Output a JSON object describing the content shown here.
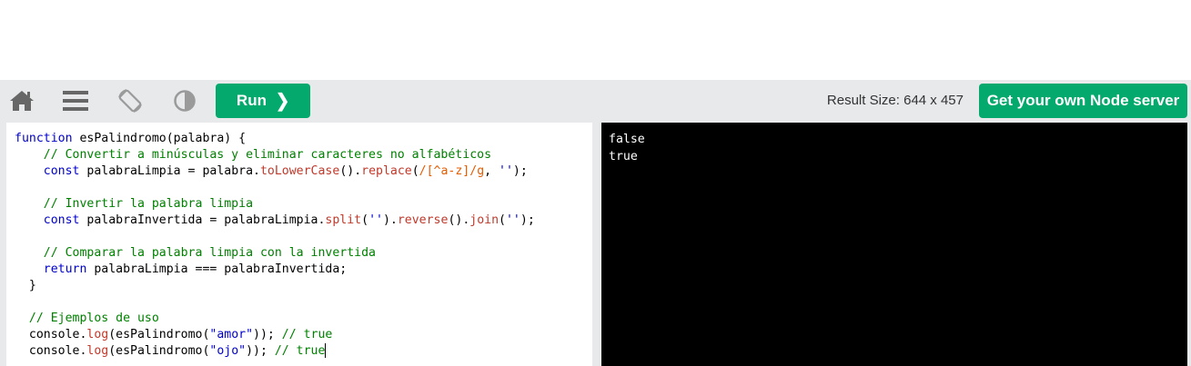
{
  "toolbar": {
    "icons": {
      "home": "home-icon",
      "menu": "menu-icon",
      "rotate": "rotate-screen-icon",
      "contrast": "contrast-icon"
    },
    "run_label": "Run",
    "run_chevron": "❯",
    "result_size_label": "Result Size: 644 x 457",
    "get_server_label": "Get your own Node server",
    "colors": {
      "accent": "#04aa6d",
      "toolbar_bg": "#e7e9eb",
      "icon": "#676767"
    }
  },
  "editor": {
    "lines": [
      [
        {
          "t": "function",
          "c": "kw"
        },
        {
          "t": " esPalindromo(palabra) {",
          "c": ""
        }
      ],
      [
        {
          "t": "    // Convertir a minúsculas y eliminar caracteres no alfabéticos",
          "c": "cm"
        }
      ],
      [
        {
          "t": "    ",
          "c": ""
        },
        {
          "t": "const",
          "c": "kw"
        },
        {
          "t": " palabraLimpia = palabra.",
          "c": ""
        },
        {
          "t": "toLowerCase",
          "c": "mth"
        },
        {
          "t": "().",
          "c": ""
        },
        {
          "t": "replace",
          "c": "mth"
        },
        {
          "t": "(",
          "c": ""
        },
        {
          "t": "/[^a-z]/g",
          "c": "re"
        },
        {
          "t": ", ",
          "c": ""
        },
        {
          "t": "''",
          "c": "str"
        },
        {
          "t": ");",
          "c": ""
        }
      ],
      [
        {
          "t": "",
          "c": ""
        }
      ],
      [
        {
          "t": "    // Invertir la palabra limpia",
          "c": "cm"
        }
      ],
      [
        {
          "t": "    ",
          "c": ""
        },
        {
          "t": "const",
          "c": "kw"
        },
        {
          "t": " palabraInvertida = palabraLimpia.",
          "c": ""
        },
        {
          "t": "split",
          "c": "mth"
        },
        {
          "t": "(",
          "c": ""
        },
        {
          "t": "''",
          "c": "str"
        },
        {
          "t": ").",
          "c": ""
        },
        {
          "t": "reverse",
          "c": "mth"
        },
        {
          "t": "().",
          "c": ""
        },
        {
          "t": "join",
          "c": "mth"
        },
        {
          "t": "(",
          "c": ""
        },
        {
          "t": "''",
          "c": "str"
        },
        {
          "t": ");",
          "c": ""
        }
      ],
      [
        {
          "t": "",
          "c": ""
        }
      ],
      [
        {
          "t": "    // Comparar la palabra limpia con la invertida",
          "c": "cm"
        }
      ],
      [
        {
          "t": "    ",
          "c": ""
        },
        {
          "t": "return",
          "c": "kw"
        },
        {
          "t": " palabraLimpia === palabraInvertida;",
          "c": ""
        }
      ],
      [
        {
          "t": "  }",
          "c": ""
        }
      ],
      [
        {
          "t": "",
          "c": ""
        }
      ],
      [
        {
          "t": "  // Ejemplos de uso",
          "c": "cm"
        }
      ],
      [
        {
          "t": "  console.",
          "c": ""
        },
        {
          "t": "log",
          "c": "mth"
        },
        {
          "t": "(esPalindromo(",
          "c": ""
        },
        {
          "t": "\"amor\"",
          "c": "str"
        },
        {
          "t": ")); ",
          "c": ""
        },
        {
          "t": "// true",
          "c": "cm"
        }
      ],
      [
        {
          "t": "  console.",
          "c": ""
        },
        {
          "t": "log",
          "c": "mth"
        },
        {
          "t": "(esPalindromo(",
          "c": ""
        },
        {
          "t": "\"ojo\"",
          "c": "str"
        },
        {
          "t": ")); ",
          "c": ""
        },
        {
          "t": "// true",
          "c": "cm"
        }
      ]
    ],
    "caret_line": 13
  },
  "result": {
    "lines": [
      "false",
      "true"
    ]
  }
}
